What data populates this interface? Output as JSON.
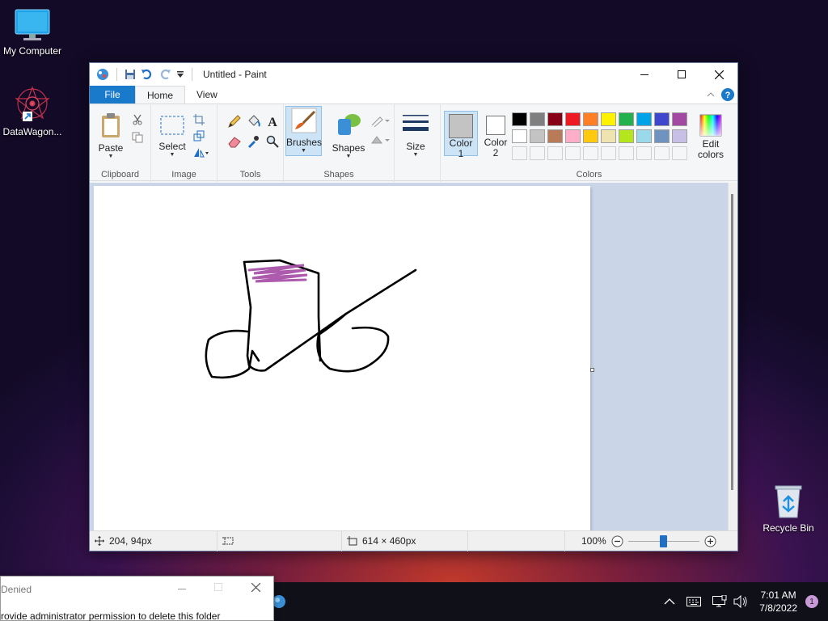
{
  "desktop": {
    "icons": [
      {
        "label": "My Computer"
      },
      {
        "label": "DataWagon..."
      },
      {
        "label": "Recycle Bin"
      }
    ]
  },
  "window": {
    "title": "Untitled - Paint",
    "tabs": {
      "file": "File",
      "home": "Home",
      "view": "View"
    }
  },
  "ribbon": {
    "clipboard": {
      "label": "Clipboard",
      "paste": "Paste"
    },
    "image": {
      "label": "Image",
      "select": "Select"
    },
    "tools": {
      "label": "Tools"
    },
    "brushes": {
      "label": "Brushes"
    },
    "shapes": {
      "label": "Shapes",
      "shapes_btn": "Shapes"
    },
    "size": {
      "label": "Size"
    },
    "colors": {
      "label": "Colors",
      "color1": "Color\n1",
      "color1_line1": "Color",
      "color1_line2": "1",
      "color2_line1": "Color",
      "color2_line2": "2",
      "edit_line1": "Edit",
      "edit_line2": "colors",
      "color1_value": "#c3c3c3",
      "color2_value": "#ffffff",
      "palette_row1": [
        "#000000",
        "#7f7f7f",
        "#880015",
        "#ed1c24",
        "#ff7f27",
        "#fff200",
        "#22b14c",
        "#00a2e8",
        "#3f48cc",
        "#a349a4"
      ],
      "palette_row2": [
        "#ffffff",
        "#c3c3c3",
        "#b97a57",
        "#ffaec9",
        "#ffc90e",
        "#efe4b0",
        "#b5e61d",
        "#99d9ea",
        "#7092be",
        "#c8bfe7"
      ]
    }
  },
  "status": {
    "cursor_pos": "204, 94px",
    "canvas_size": "614 × 460px",
    "zoom": "100%",
    "zoom_fraction": 0.5
  },
  "dialog": {
    "title": "Denied",
    "message": "rovide administrator permission to delete this folder"
  },
  "taskbar": {
    "time": "7:01 AM",
    "date": "7/8/2022",
    "notifications": "1"
  }
}
